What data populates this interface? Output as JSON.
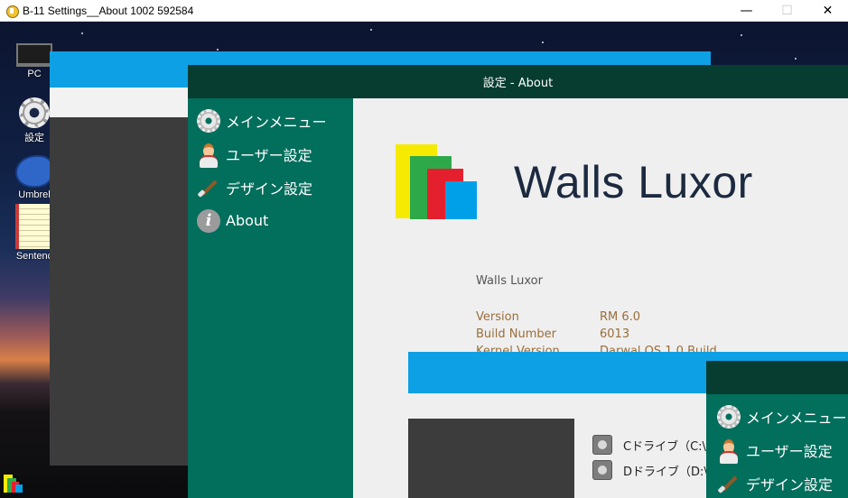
{
  "window": {
    "title": "B-11 Settings__About 1002 592584",
    "controls": {
      "minimize": "—",
      "maximize": "☐",
      "close": "✕"
    }
  },
  "desktop": {
    "icons": [
      {
        "label": "PC",
        "icon": "pc-icon"
      },
      {
        "label": "設定",
        "icon": "gear-icon"
      },
      {
        "label": "Umbrel",
        "icon": "dolphin-icon"
      },
      {
        "label": "Sentenc",
        "icon": "notepad-icon"
      }
    ]
  },
  "settings": {
    "title": "設定 - About",
    "nav": [
      {
        "label": "メインメニュー",
        "icon": "gear-icon"
      },
      {
        "label": "ユーザー設定",
        "icon": "user-icon"
      },
      {
        "label": "デザイン設定",
        "icon": "brush-icon"
      },
      {
        "label": "About",
        "icon": "info-icon"
      }
    ],
    "about": {
      "brand": "Walls Luxor",
      "app_name": "Walls Luxor",
      "rows": [
        {
          "label": "Version",
          "value": "RM 6.0"
        },
        {
          "label": "Build Number",
          "value": "6013"
        },
        {
          "label": "Kernel Version",
          "value": "Darwal OS 1.0 Build"
        }
      ],
      "drives": [
        {
          "label": "Cドライブ（C:\\"
        },
        {
          "label": "Dドライブ（D:\\"
        }
      ]
    }
  },
  "front_window": {
    "nav": [
      {
        "label": "メインメニュー",
        "icon": "gear-icon"
      },
      {
        "label": "ユーザー設定",
        "icon": "user-icon"
      },
      {
        "label": "デザイン設定",
        "icon": "brush-icon"
      }
    ]
  },
  "colors": {
    "title_bar": "#063d30",
    "sidebar": "#026e5c",
    "accent_blue": "#0ea0e4",
    "content_bg": "#efefef",
    "logo": [
      "#f6ea00",
      "#2ea94a",
      "#e5202e",
      "#00a0e9"
    ]
  }
}
